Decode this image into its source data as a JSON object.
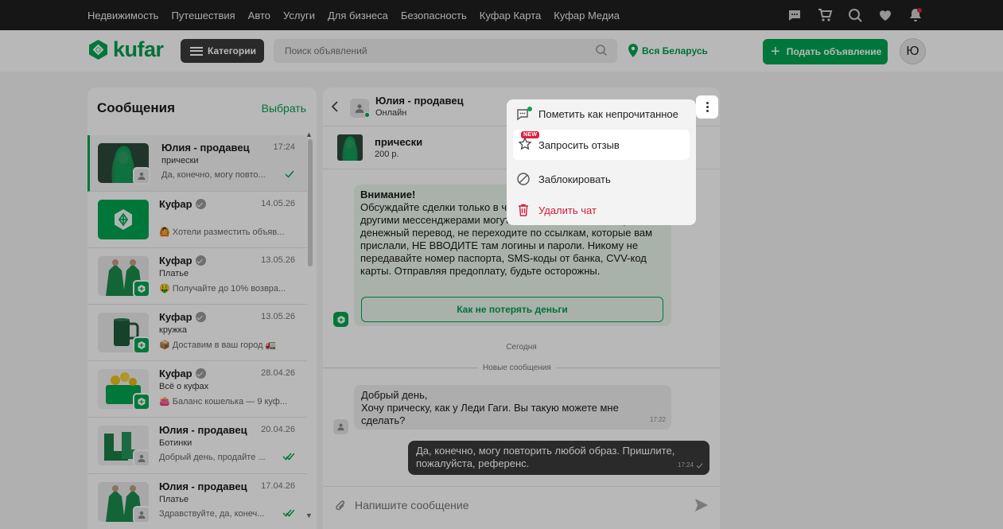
{
  "topnav": {
    "links": [
      "Недвижимость",
      "Путешествия",
      "Авто",
      "Услуги",
      "Для бизнеса",
      "Безопасность",
      "Куфар Карта",
      "Куфар Медиа"
    ],
    "icons": [
      "chat-icon",
      "cart-icon",
      "compare-heart-icon",
      "heart-icon",
      "bell-icon"
    ]
  },
  "header": {
    "logo_text": "kufar",
    "categories_label": "Категории",
    "search_placeholder": "Поиск объявлений",
    "region_label": "Вся Беларусь",
    "post_button_label": "Подать объявление",
    "avatar_letter": "Ю"
  },
  "messages": {
    "title": "Сообщения",
    "select_label": "Выбрать",
    "conversations": [
      {
        "name": "Юлия - продавец",
        "date": "17:24",
        "subject": "прически",
        "preview": "Да, конечно, могу повто...",
        "verified": false,
        "check": "single",
        "active": true
      },
      {
        "name": "Куфар",
        "date": "14.05.26",
        "subject": "",
        "preview": "🙆 Хотели разместить объяв...",
        "verified": true,
        "check": "none",
        "active": false
      },
      {
        "name": "Куфар",
        "date": "13.05.26",
        "subject": "Платье",
        "preview": "🤑 Получайте до 10% возвра...",
        "verified": true,
        "check": "none",
        "active": false
      },
      {
        "name": "Куфар",
        "date": "13.05.26",
        "subject": "кружка",
        "preview": "📦 Доставим в ваш город 🚛",
        "verified": true,
        "check": "none",
        "active": false
      },
      {
        "name": "Куфар",
        "date": "28.04.26",
        "subject": "Всё о куфах",
        "preview": "👛 Баланс кошелька — 9 куф...",
        "verified": true,
        "check": "none",
        "active": false
      },
      {
        "name": "Юлия - продавец",
        "date": "20.04.26",
        "subject": "Ботинки",
        "preview": "Добрый день, продайте ...",
        "verified": false,
        "check": "double",
        "active": false
      },
      {
        "name": "Юлия - продавец",
        "date": "17.04.26",
        "subject": "Платье",
        "preview": "Здравствуйте, да, конеч...",
        "verified": false,
        "check": "double",
        "active": false
      }
    ]
  },
  "chat": {
    "contact_name": "Юлия - продавец",
    "contact_status": "Онлайн",
    "item_title": "прически",
    "item_price": "200 р.",
    "warning_title": "Внимание!",
    "warning_text": "Обсуждайте сделки только в чате Куфара — не переходите в другими мессенджерами могут мошенники. Чтобы получить денежный перевод, не переходите по ссылкам, которые вам прислали, НЕ ВВОДИТЕ там логины и пароли. Никому не передавайте номер паспорта, SMS-коды от банка, CVV-код карты. Отправляя предоплату, будьте осторожны.",
    "warning_button": "Как не потерять деньги",
    "day_label": "Сегодня",
    "new_messages_label": "Новые сообщения",
    "incoming_text": "Добрый день,\nХочу прическу, как у Леди Гаги. Вы такую можете мне сделать?",
    "incoming_time": "17:22",
    "outgoing_text": "Да, конечно, могу повторить любой образ. Пришлите, пожалуйста, референс.",
    "outgoing_time": "17:24",
    "composer_placeholder": "Напишите сообщение"
  },
  "menu": {
    "items": [
      {
        "label": "Пометить как непрочитанное",
        "icon": "chat-unread-icon",
        "badge": ""
      },
      {
        "label": "Запросить отзыв",
        "icon": "star-icon",
        "badge": "NEW"
      },
      {
        "label": "Заблокировать",
        "icon": "block-icon",
        "badge": ""
      },
      {
        "label": "Удалить чат",
        "icon": "trash-icon",
        "badge": ""
      }
    ]
  },
  "colors": {
    "brand_green": "#00a651",
    "danger": "#d21c3a",
    "topbar": "#1f1f1f",
    "overlay": "rgba(0,0,0,0.28)"
  }
}
